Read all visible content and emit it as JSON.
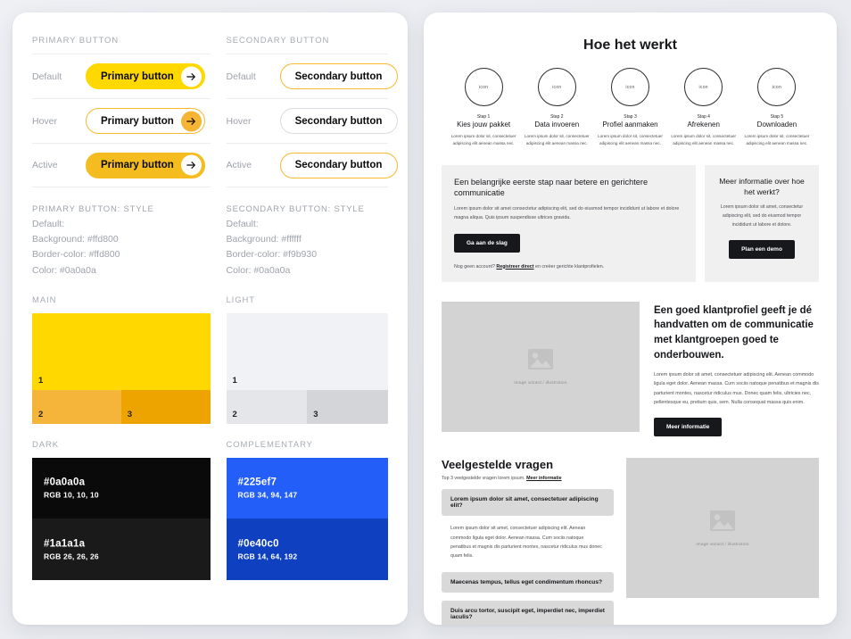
{
  "left_panel": {
    "primary": {
      "section_title": "PRIMARY BUTTON",
      "states": [
        {
          "state": "Default",
          "label": "Primary button"
        },
        {
          "state": "Hover",
          "label": "Primary button"
        },
        {
          "state": "Active",
          "label": "Primary button"
        }
      ],
      "style": {
        "heading": "PRIMARY BUTTON: STYLE",
        "state_line": "Default:",
        "background": "Background: #ffd800",
        "border_color": "Border-color: #ffd800",
        "color": "Color: #0a0a0a"
      }
    },
    "secondary": {
      "section_title": "SECONDARY BUTTON",
      "states": [
        {
          "state": "Default",
          "label": "Secondary button"
        },
        {
          "state": "Hover",
          "label": "Secondary button"
        },
        {
          "state": "Active",
          "label": "Secondary button"
        }
      ],
      "style": {
        "heading": "SECONDARY BUTTON: STYLE",
        "state_line": "Default:",
        "background": "Background: #ffffff",
        "border_color": "Border-color: #f9b930",
        "color": "Color: #0a0a0a"
      }
    },
    "palettes": [
      {
        "title": "MAIN",
        "swatches": [
          {
            "num": "1",
            "hex": "#ffd800"
          },
          {
            "num": "2",
            "hex": "#f5b53b"
          },
          {
            "num": "3",
            "hex": "#eda400"
          }
        ]
      },
      {
        "title": "LIGHT",
        "swatches": [
          {
            "num": "1",
            "hex": "#f1f2f5"
          },
          {
            "num": "2",
            "hex": "#e4e6e9"
          },
          {
            "num": "3",
            "hex": "#d3d5d8"
          }
        ]
      },
      {
        "title": "DARK",
        "swatches": [
          {
            "num": "",
            "hex": "#0a0a0a",
            "hex_label": "#0a0a0a",
            "rgb_label": "RGB 10, 10, 10"
          },
          {
            "num": "",
            "hex": "#1a1a1a",
            "hex_label": "#1a1a1a",
            "rgb_label": "RGB 26, 26, 26"
          }
        ]
      },
      {
        "title": "COMPLEMENTARY",
        "swatches": [
          {
            "num": "",
            "hex": "#225ef7",
            "hex_label": "#225ef7",
            "rgb_label": "RGB 34, 94, 147"
          },
          {
            "num": "",
            "hex": "#0e40c0",
            "hex_label": "#0e40c0",
            "rgb_label": "RGB 14, 64, 192"
          }
        ]
      }
    ]
  },
  "right_panel": {
    "page_title": "Hoe het werkt",
    "icon_placeholder": "icon",
    "steps": [
      {
        "num": "Stap 1",
        "title": "Kies jouw pakket",
        "desc": "Lorem ipsum dolor sit, consectetuer adipiscing elit aenean massa nec."
      },
      {
        "num": "Stap 2",
        "title": "Data invoeren",
        "desc": "Lorem ipsum dolor sit, consectetuer adipiscing elit aenean massa nec."
      },
      {
        "num": "Stap 3",
        "title": "Profiel aanmaken",
        "desc": "Lorem ipsum dolor sit, consectetuer adipiscing elit aenean massa nec."
      },
      {
        "num": "Stap 4",
        "title": "Afrekenen",
        "desc": "Lorem ipsum dolor sit, consectetuer adipiscing elit aenean massa nec."
      },
      {
        "num": "Stap 5",
        "title": "Downloaden",
        "desc": "Lorem ipsum dolor sit, consectetuer adipiscing elit aenean massa nec."
      }
    ],
    "cta_main": {
      "heading": "Een belangrijke eerste stap naar betere en gerichtere communicatie",
      "body": "Lorem ipsum dolor sit amet consectetur adipiscing elit, sed do eiusmod tempor incididunt ut labore et dolore magna aliqua. Quis ipsum suspendisse ultrices gravida.",
      "button": "Ga aan de slag",
      "footnote_pre": "Nog geen account? ",
      "footnote_link": "Registreer direct",
      "footnote_post": " en creëer gerichte klantprofielen."
    },
    "cta_side": {
      "heading": "Meer informatie over hoe het werkt?",
      "body": "Lorem ipsum dolor sit amet, consectetur adipiscing elit, sed do eiusmod tempor incididunt ut labore et dolore.",
      "button": "Plan een demo"
    },
    "feature": {
      "image_placeholder": "image wizard / illustration",
      "heading": "Een goed klantprofiel geeft je dé handvatten om de communicatie met klantgroepen goed te onderbouwen.",
      "body": "Lorem ipsum dolor sit amet, consectetuer adipiscing elit. Aenean commodo ligula eget dolor. Aenean massa. Cum sociis natoque penatibus et magnis dis parturient montes, nascetur ridiculus mus. Donec quam felis, ultricies nec, pellentesque eu, pretium quis, sem. Nulla consequat massa quis enim.",
      "button": "Meer informatie"
    },
    "faq": {
      "heading": "Veelgestelde vragen",
      "sub_pre": "Top 3 veelgestelde vragen lorem ipsum. ",
      "sub_link": "Meer informatie",
      "items": [
        {
          "question": "Lorem ipsum dolor sit amet, consectetuer adipiscing elit?",
          "answer": "Lorem ipsum dolor sit amet, consectetuer adipiscing elit. Aenean commodo ligula eget dolor. Aenean massa. Cum sociis natoque penatibus et magnis dis parturient montes, nascetur ridiculus mus donec quam felis."
        },
        {
          "question": "Maecenas tempus, tellus eget condimentum rhoncus?",
          "answer": ""
        },
        {
          "question": "Duis arcu tortor, suscipit eget, imperdiet nec, imperdiet iaculis?",
          "answer": ""
        }
      ],
      "image_placeholder": "image wizard / illustration"
    }
  }
}
